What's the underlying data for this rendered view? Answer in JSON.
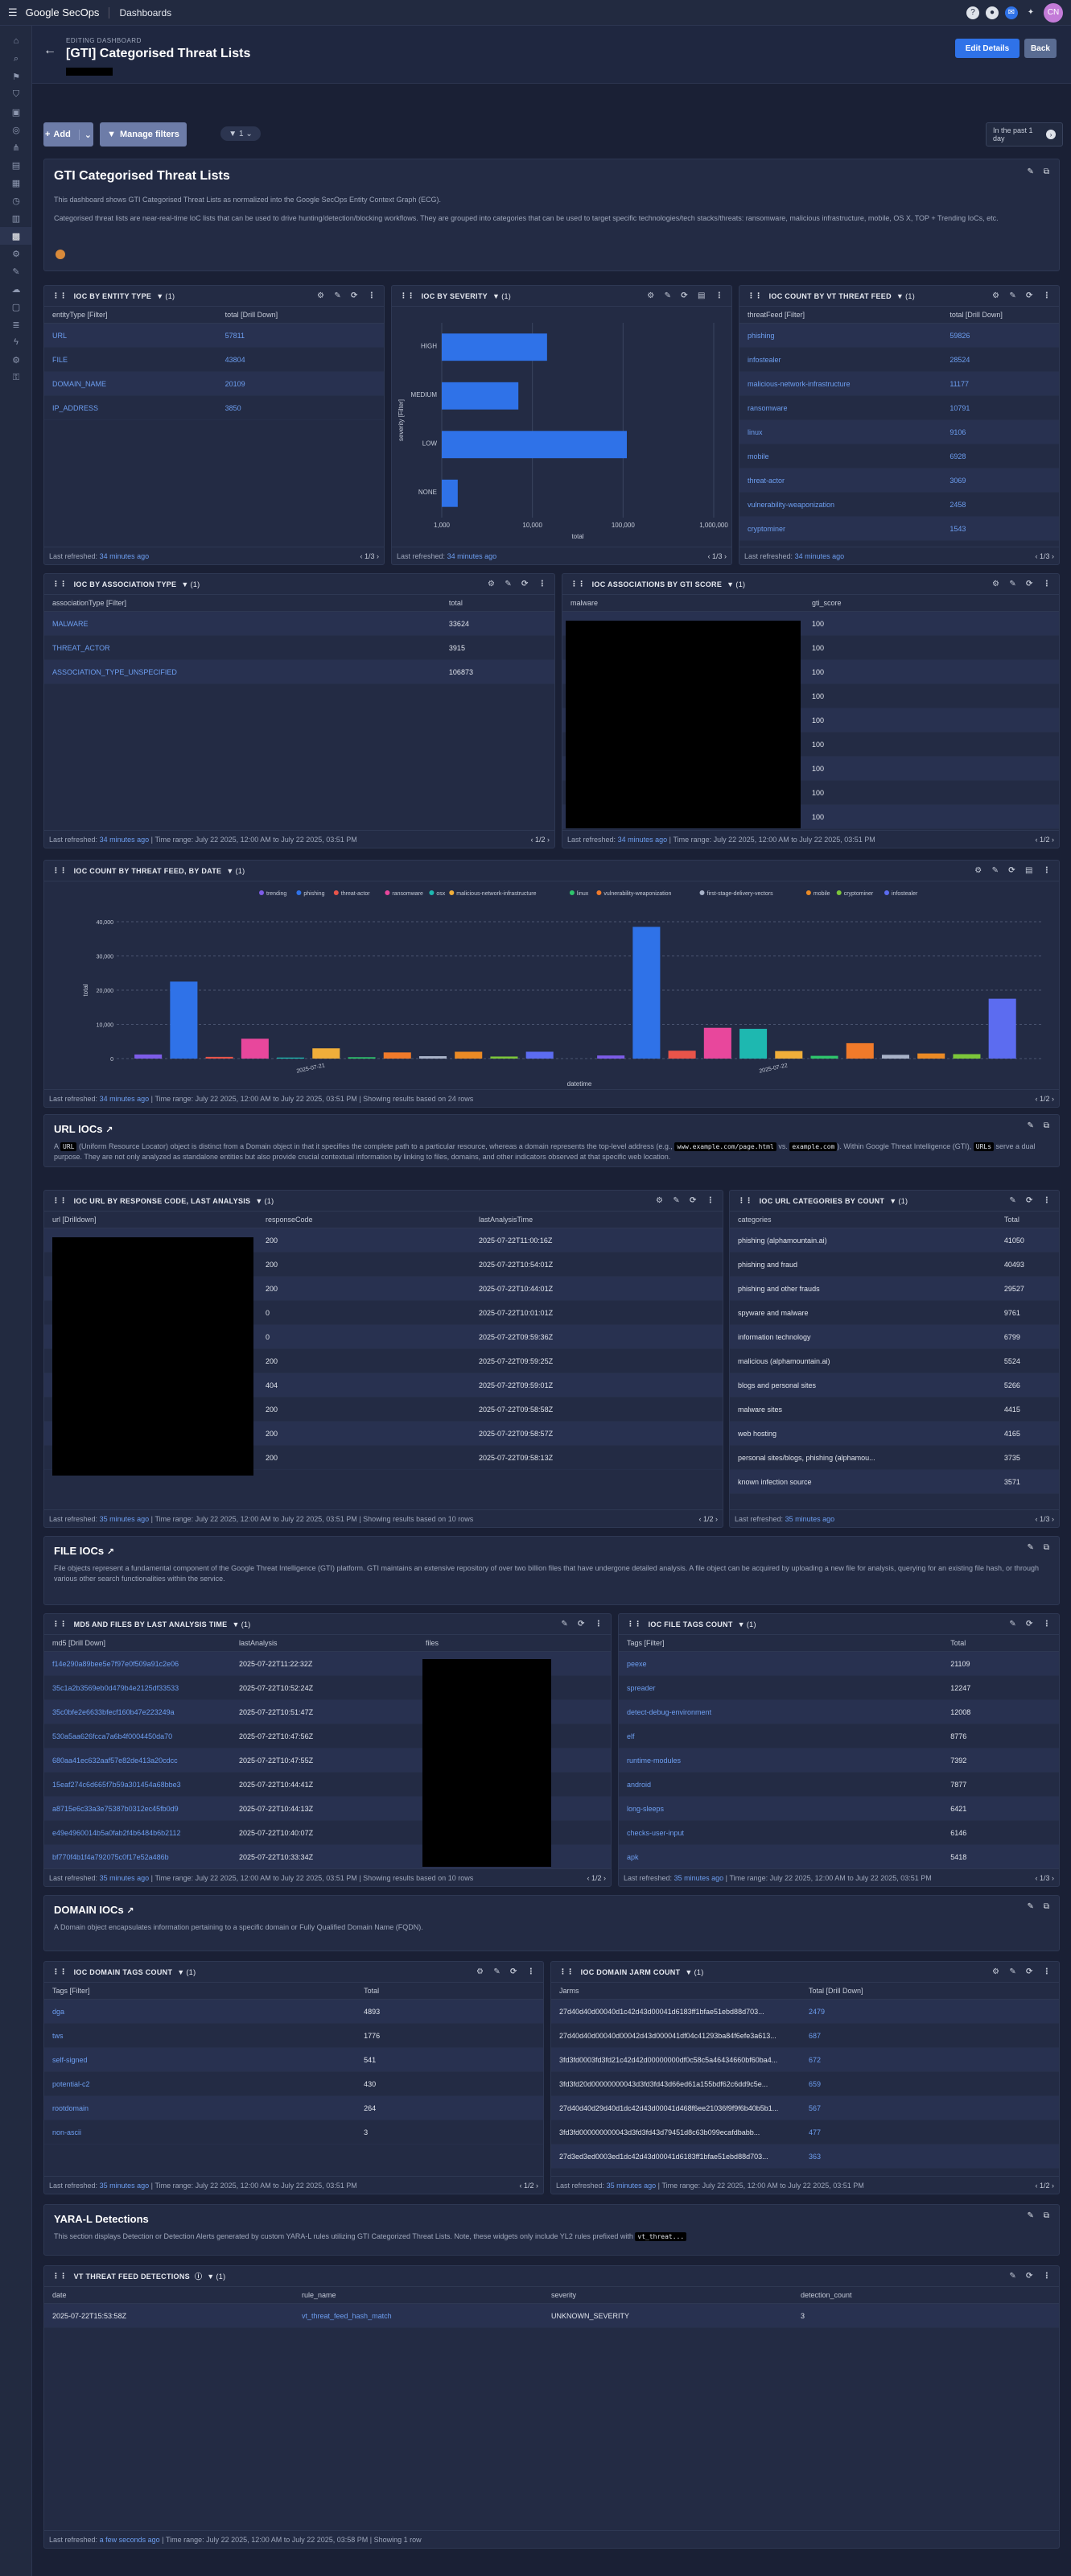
{
  "topbar": {
    "brand": "Google SecOps",
    "crumb": "Dashboards",
    "avatar": "CN"
  },
  "header": {
    "eyebrow": "EDITING DASHBOARD",
    "title": "[GTI] Categorised Threat Lists",
    "edit_details": "Edit Details",
    "back": "Back"
  },
  "filters": {
    "add": "Add",
    "manage": "Manage filters",
    "timerange": "In the past 1 day"
  },
  "intro": {
    "title": "GTI Categorised Threat Lists",
    "desc1": "This dashboard shows GTI Categorised Threat Lists as normalized into the Google SecOps Entity Context Graph (ECG).",
    "desc2": "Categorised threat lists are near-real-time IoC lists that can be used to drive hunting/detection/blocking workflows. They are grouped into categories that can be used to target specific technologies/tech stacks/threats: ransomware, malicious infrastructure, mobile, OS X, TOP + Trending IoCs, etc."
  },
  "common": {
    "last_refreshed": "Last refreshed:",
    "time_range": "Time range: July 22 2025, 12:00 AM to July 22 2025, 03:51 PM",
    "time_range_vt": "Time range: July 22 2025, 12:00 AM to July 22 2025, 03:58 PM"
  },
  "entity_type": {
    "title": "IOC BY ENTITY TYPE",
    "filter_count": "(1)",
    "cols": [
      "entityType [Filter]",
      "total [Drill Down]"
    ],
    "rows": [
      [
        "URL",
        "57811"
      ],
      [
        "FILE",
        "43804"
      ],
      [
        "DOMAIN_NAME",
        "20109"
      ],
      [
        "IP_ADDRESS",
        "3850"
      ]
    ],
    "refreshed": "34 minutes ago",
    "pager": "1/3"
  },
  "severity": {
    "title": "IOC BY SEVERITY",
    "filter_count": "(1)",
    "refreshed": "34 minutes ago",
    "pager": "1/3"
  },
  "severity_chart": {
    "type": "bar",
    "orientation": "horizontal",
    "categories": [
      "HIGH",
      "MEDIUM",
      "LOW",
      "NONE"
    ],
    "values": [
      14500,
      7000,
      110000,
      1500
    ],
    "xscale": "log",
    "xticks": [
      "1,000",
      "10,000",
      "100,000",
      "1,000,000"
    ],
    "xlabel": "total",
    "ylabel": "severity [Filter]"
  },
  "vt_feed": {
    "title": "IOC COUNT BY VT THREAT FEED",
    "filter_count": "(1)",
    "cols": [
      "threatFeed [Filter]",
      "total [Drill Down]"
    ],
    "rows": [
      [
        "phishing",
        "59826"
      ],
      [
        "infostealer",
        "28524"
      ],
      [
        "malicious-network-infrastructure",
        "11177"
      ],
      [
        "ransomware",
        "10791"
      ],
      [
        "linux",
        "9106"
      ],
      [
        "mobile",
        "6928"
      ],
      [
        "threat-actor",
        "3069"
      ],
      [
        "vulnerability-weaponization",
        "2458"
      ],
      [
        "cryptominer",
        "1543"
      ]
    ],
    "refreshed": "34 minutes ago",
    "pager": "1/3"
  },
  "association": {
    "title": "IOC BY ASSOCIATION TYPE",
    "filter_count": "(1)",
    "cols": [
      "associationType [Filter]",
      "total"
    ],
    "rows": [
      [
        "MALWARE",
        "33624"
      ],
      [
        "THREAT_ACTOR",
        "3915"
      ],
      [
        "ASSOCIATION_TYPE_UNSPECIFIED",
        "106873"
      ]
    ],
    "refreshed": "34 minutes ago",
    "pager": "1/2"
  },
  "gti_score": {
    "title": "IOC ASSOCIATIONS BY GTI SCORE",
    "filter_count": "(1)",
    "cols": [
      "malware",
      "gti_score"
    ],
    "scores": [
      "100",
      "100",
      "100",
      "100",
      "100",
      "100",
      "100",
      "100",
      "100",
      "100"
    ],
    "refreshed": "34 minutes ago",
    "pager": "1/2"
  },
  "by_date": {
    "title": "IOC COUNT BY THREAT FEED, BY DATE",
    "filter_count": "(1)",
    "footnote": "Showing results based on 24 rows",
    "refreshed": "34 minutes ago",
    "pager": "1/2"
  },
  "by_date_chart": {
    "type": "bar",
    "x": [
      "2025-07-21",
      "2025-07-22"
    ],
    "xlabel": "datetime",
    "ylabel": "total",
    "yticks": [
      "0",
      "10,000",
      "20,000",
      "30,000",
      "40,000"
    ],
    "ylim": [
      0,
      40000
    ],
    "series": [
      {
        "name": "trending",
        "color": "#7d5ce8",
        "values": [
          1200,
          900
        ]
      },
      {
        "name": "phishing",
        "color": "#2f72e8",
        "values": [
          22500,
          38500
        ]
      },
      {
        "name": "threat-actor",
        "color": "#e8544a",
        "values": [
          500,
          2300
        ]
      },
      {
        "name": "ransomware",
        "color": "#e8479c",
        "values": [
          5800,
          9000
        ]
      },
      {
        "name": "osx",
        "color": "#1eb8b0",
        "values": [
          300,
          8700
        ]
      },
      {
        "name": "malicious-network-infrastructure",
        "color": "#f0ae3a",
        "values": [
          3000,
          2200
        ]
      },
      {
        "name": "linux",
        "color": "#2ec56c",
        "values": [
          400,
          800
        ]
      },
      {
        "name": "vulnerability-weaponization",
        "color": "#f07a2a",
        "values": [
          1800,
          4500
        ]
      },
      {
        "name": "first-stage-delivery-vectors",
        "color": "#a8b2c8",
        "values": [
          700,
          1100
        ]
      },
      {
        "name": "mobile",
        "color": "#ea8a25",
        "values": [
          2000,
          1500
        ]
      },
      {
        "name": "cryptominer",
        "color": "#7cc63a",
        "values": [
          600,
          1300
        ]
      },
      {
        "name": "infostealer",
        "color": "#5c6cf0",
        "values": [
          2000,
          17500
        ]
      }
    ]
  },
  "url_section": {
    "title": "URL IOCs",
    "desc_a": "A",
    "code1": "URL",
    "desc_b": "(Uniform Resource Locator) object is distinct from a Domain object in that it specifies the complete path to a particular resource, whereas a domain represents the top-level address (e.g.,",
    "code2": "www.example.com/page.html",
    "desc_c": "vs.",
    "code3": "example.com",
    "desc_d": "). Within Google Threat Intelligence (GTI),",
    "code4": "URLs",
    "desc_e": "serve a dual purpose. They are not only analyzed as standalone entities but also provide crucial contextual information by linking to files, domains, and other indicators observed at that specific web location."
  },
  "url_response": {
    "title": "IOC URL BY RESPONSE CODE, LAST ANALYSIS",
    "filter_count": "(1)",
    "cols": [
      "url [Drilldown]",
      "responseCode",
      "lastAnalysisTime"
    ],
    "rows": [
      [
        "200",
        "2025-07-22T11:00:16Z"
      ],
      [
        "200",
        "2025-07-22T10:54:01Z"
      ],
      [
        "200",
        "2025-07-22T10:44:01Z"
      ],
      [
        "0",
        "2025-07-22T10:01:01Z"
      ],
      [
        "0",
        "2025-07-22T09:59:36Z"
      ],
      [
        "200",
        "2025-07-22T09:59:25Z"
      ],
      [
        "404",
        "2025-07-22T09:59:01Z"
      ],
      [
        "200",
        "2025-07-22T09:58:58Z"
      ],
      [
        "200",
        "2025-07-22T09:58:57Z"
      ],
      [
        "200",
        "2025-07-22T09:58:13Z"
      ]
    ],
    "footnote": "Showing results based on 10 rows",
    "refreshed": "35 minutes ago",
    "pager": "1/2"
  },
  "url_categories": {
    "title": "IOC URL CATEGORIES BY COUNT",
    "filter_count": "(1)",
    "cols": [
      "categories",
      "Total"
    ],
    "rows": [
      [
        "phishing (alphamountain.ai)",
        "41050"
      ],
      [
        "phishing and fraud",
        "40493"
      ],
      [
        "phishing and other frauds",
        "29527"
      ],
      [
        "spyware and malware",
        "9761"
      ],
      [
        "information technology",
        "6799"
      ],
      [
        "malicious (alphamountain.ai)",
        "5524"
      ],
      [
        "blogs and personal sites",
        "5266"
      ],
      [
        "malware sites",
        "4415"
      ],
      [
        "web hosting",
        "4165"
      ],
      [
        "personal sites/blogs, phishing (alphamou...",
        "3735"
      ],
      [
        "known infection source",
        "3571"
      ]
    ],
    "refreshed": "35 minutes ago",
    "pager": "1/3"
  },
  "file_section": {
    "title": "FILE IOCs",
    "desc": "File objects represent a fundamental component of the Google Threat Intelligence (GTI) platform. GTI maintains an extensive repository of over two billion files that have undergone detailed analysis. A file object can be acquired by uploading a new file for analysis, querying for an existing file hash, or through various other search functionalities within the service."
  },
  "md5_files": {
    "title": "MD5 AND FILES BY LAST ANALYSIS TIME",
    "filter_count": "(1)",
    "cols": [
      "md5 [Drill Down]",
      "lastAnalysis",
      "files"
    ],
    "rows": [
      [
        "f14e290a89bee5e7f97e0f509a91c2e06",
        "2025-07-22T11:22:32Z"
      ],
      [
        "35c1a2b3569eb0d479b4e2125df33533",
        "2025-07-22T10:52:24Z"
      ],
      [
        "35c0bfe2e6633bfecf160b47e223249a",
        "2025-07-22T10:51:47Z"
      ],
      [
        "530a5aa626fcca7a6b4f0004450da70",
        "2025-07-22T10:47:56Z"
      ],
      [
        "680aa41ec632aaf57e82de413a20cdcc",
        "2025-07-22T10:47:55Z"
      ],
      [
        "15eaf274c6d665f7b59a301454a68bbe3",
        "2025-07-22T10:44:41Z"
      ],
      [
        "a8715e6c33a3e75387b0312ec45fb0d9",
        "2025-07-22T10:44:13Z"
      ],
      [
        "e49e4960014b5a0fab2f4b6484b6b2112",
        "2025-07-22T10:40:07Z"
      ],
      [
        "bf770f4b1f4a792075c0f17e52a486b",
        "2025-07-22T10:33:34Z"
      ]
    ],
    "footnote": "Showing results based on 10 rows",
    "refreshed": "35 minutes ago",
    "pager": "1/2"
  },
  "file_tags": {
    "title": "IOC FILE TAGS COUNT",
    "filter_count": "(1)",
    "cols": [
      "Tags [Filter]",
      "Total"
    ],
    "rows": [
      [
        "peexe",
        "21109"
      ],
      [
        "spreader",
        "12247"
      ],
      [
        "detect-debug-environment",
        "12008"
      ],
      [
        "elf",
        "8776"
      ],
      [
        "runtime-modules",
        "7392"
      ],
      [
        "android",
        "7877"
      ],
      [
        "long-sleeps",
        "6421"
      ],
      [
        "checks-user-input",
        "6146"
      ],
      [
        "apk",
        "5418"
      ]
    ],
    "refreshed": "35 minutes ago",
    "pager": "1/3"
  },
  "domain_section": {
    "title": "DOMAIN IOCs",
    "desc": "A Domain object encapsulates information pertaining to a specific domain or Fully Qualified Domain Name (FQDN)."
  },
  "domain_tags": {
    "title": "IOC DOMAIN TAGS COUNT",
    "filter_count": "(1)",
    "cols": [
      "Tags [Filter]",
      "Total"
    ],
    "rows": [
      [
        "dga",
        "4893"
      ],
      [
        "tws",
        "1776"
      ],
      [
        "self-signed",
        "541"
      ],
      [
        "potential-c2",
        "430"
      ],
      [
        "rootdomain",
        "264"
      ],
      [
        "non-ascii",
        "3"
      ]
    ],
    "refreshed": "35 minutes ago",
    "pager": "1/2"
  },
  "domain_jarm": {
    "title": "IOC DOMAIN JARM COUNT",
    "filter_count": "(1)",
    "cols": [
      "Jarms",
      "Total [Drill Down]"
    ],
    "rows": [
      [
        "27d40d40d00040d1c42d43d00041d6183ff1bfae51ebd88d703...",
        "2479"
      ],
      [
        "27d40d40d00040d00042d43d000041df04c41293ba84f6efe3a613...",
        "687"
      ],
      [
        "3fd3fd0003fd3fd21c42d42d00000000df0c58c5a46434660bf60ba4...",
        "672"
      ],
      [
        "3fd3fd20d00000000043d3fd3fd43d66ed61a155bdf62c6dd9c5e...",
        "659"
      ],
      [
        "27d40d40d29d40d1dc42d43d00041d468f6ee21036f9f9f6b40b5b1...",
        "567"
      ],
      [
        "3fd3fd000000000043d3fd3fd43d79451d8c63b099ecafdbabb...",
        "477"
      ],
      [
        "27d3ed3ed0003ed1dc42d43d00041d6183ff1bfae51ebd88d703...",
        "363"
      ]
    ],
    "refreshed": "35 minutes ago",
    "pager": "1/2"
  },
  "yara_section": {
    "title": "YARA-L Detections",
    "desc": "This section displays Detection or Detection Alerts generated by custom YARA-L rules utilizing GTI Categorized Threat Lists. Note, these widgets only include YL2 rules prefixed with",
    "code": "vt_threat..."
  },
  "vt_detections": {
    "title": "VT THREAT FEED DETECTIONS",
    "filter_count": "(1)",
    "cols": [
      "date",
      "rule_name",
      "severity",
      "detection_count"
    ],
    "rows": [
      [
        "2025-07-22T15:53:58Z",
        "vt_threat_feed_hash_match",
        "UNKNOWN_SEVERITY",
        "3"
      ]
    ],
    "refreshed": "a few seconds ago",
    "footnote": "Showing 1 row"
  }
}
